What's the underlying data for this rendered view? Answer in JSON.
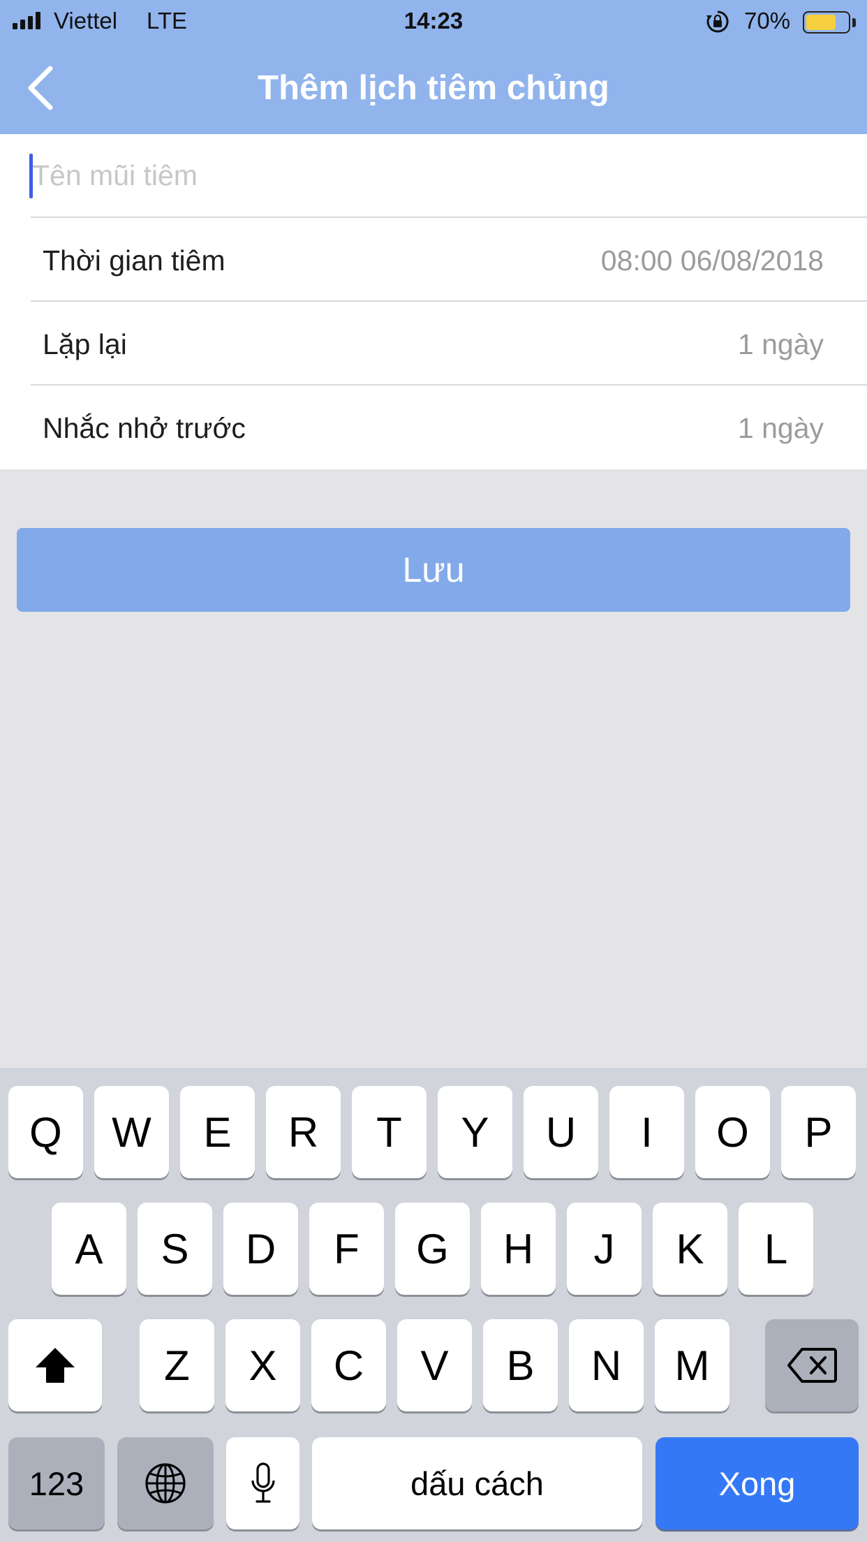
{
  "status_bar": {
    "carrier": "Viettel",
    "network": "LTE",
    "time": "14:23",
    "battery_percent": "70%",
    "battery_level": 0.7,
    "battery_color": "#f6cf3f",
    "icons": [
      "signal-bars-icon",
      "orientation-lock-icon",
      "battery-icon"
    ]
  },
  "nav": {
    "back_icon": "chevron-left-icon",
    "title": "Thêm lịch tiêm chủng"
  },
  "form": {
    "name_field": {
      "placeholder": "Tên mũi tiêm",
      "value": ""
    },
    "rows": [
      {
        "label": "Thời gian tiêm",
        "value": "08:00 06/08/2018"
      },
      {
        "label": "Lặp lại",
        "value": "1 ngày"
      },
      {
        "label": "Nhắc nhở trước",
        "value": "1 ngày"
      }
    ]
  },
  "save_button": {
    "label": "Lưu",
    "color": "#82aaea"
  },
  "keyboard": {
    "row1": [
      "Q",
      "W",
      "E",
      "R",
      "T",
      "Y",
      "U",
      "I",
      "O",
      "P"
    ],
    "row2": [
      "A",
      "S",
      "D",
      "F",
      "G",
      "H",
      "J",
      "K",
      "L"
    ],
    "row3": [
      "Z",
      "X",
      "C",
      "V",
      "B",
      "N",
      "M"
    ],
    "numbers_label": "123",
    "space_label": "dấu cách",
    "done_label": "Xong",
    "done_color": "#3478f6",
    "icons": [
      "shift-icon",
      "backspace-icon",
      "globe-icon",
      "microphone-icon"
    ]
  },
  "colors": {
    "header": "#91b4ec",
    "caret": "#3f5de6",
    "background": "#e4e4e6"
  }
}
